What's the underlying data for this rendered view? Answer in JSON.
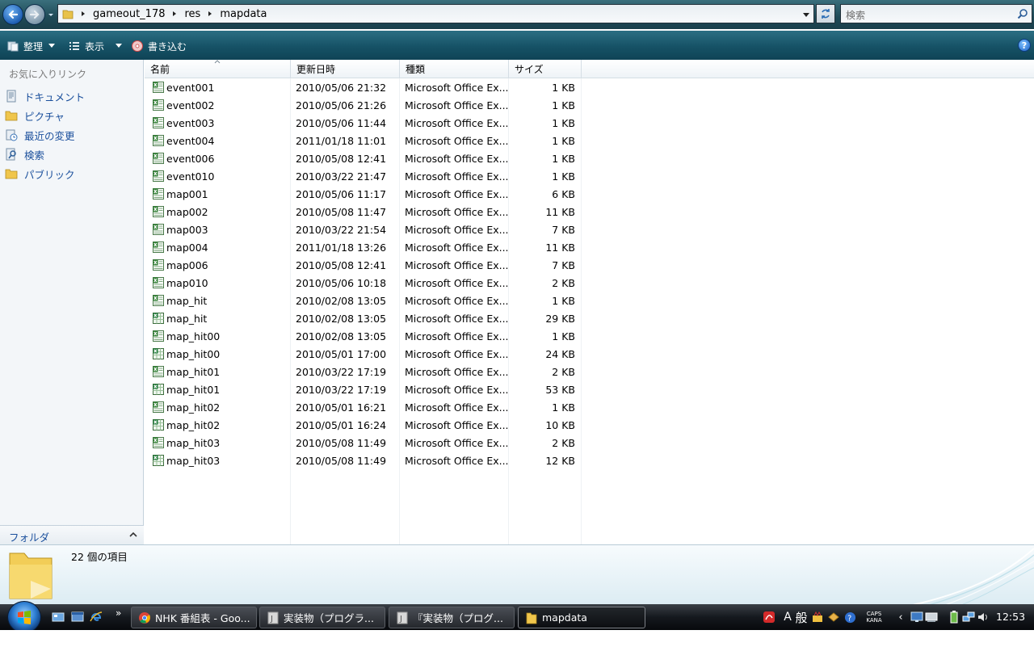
{
  "address": {
    "breadcrumbs": [
      "gameout_178",
      "res",
      "mapdata"
    ],
    "search_placeholder": "検索"
  },
  "commands": {
    "organize": "整理",
    "views": "表示",
    "burn": "書き込む"
  },
  "nav_pane": {
    "favorites_title": "お気に入りリンク",
    "items": [
      {
        "label": "ドキュメント",
        "icon": "documents-icon"
      },
      {
        "label": "ピクチャ",
        "icon": "pictures-folder-icon"
      },
      {
        "label": "最近の変更",
        "icon": "recent-changes-icon"
      },
      {
        "label": "検索",
        "icon": "searches-icon"
      },
      {
        "label": "パブリック",
        "icon": "public-folder-icon"
      }
    ],
    "folders_label": "フォルダ"
  },
  "file_list": {
    "columns": [
      "名前",
      "更新日時",
      "種類",
      "サイズ"
    ],
    "rows": [
      {
        "name": "event001",
        "date": "2010/05/06 21:32",
        "type": "Microsoft Office Ex...",
        "size": "1 KB",
        "icon": "excel-csv-icon"
      },
      {
        "name": "event002",
        "date": "2010/05/06 21:26",
        "type": "Microsoft Office Ex...",
        "size": "1 KB",
        "icon": "excel-csv-icon"
      },
      {
        "name": "event003",
        "date": "2010/05/06 11:44",
        "type": "Microsoft Office Ex...",
        "size": "1 KB",
        "icon": "excel-csv-icon"
      },
      {
        "name": "event004",
        "date": "2011/01/18 11:01",
        "type": "Microsoft Office Ex...",
        "size": "1 KB",
        "icon": "excel-csv-icon"
      },
      {
        "name": "event006",
        "date": "2010/05/08 12:41",
        "type": "Microsoft Office Ex...",
        "size": "1 KB",
        "icon": "excel-csv-icon"
      },
      {
        "name": "event010",
        "date": "2010/03/22 21:47",
        "type": "Microsoft Office Ex...",
        "size": "1 KB",
        "icon": "excel-csv-icon"
      },
      {
        "name": "map001",
        "date": "2010/05/06 11:17",
        "type": "Microsoft Office Ex...",
        "size": "6 KB",
        "icon": "excel-csv-icon"
      },
      {
        "name": "map002",
        "date": "2010/05/08 11:47",
        "type": "Microsoft Office Ex...",
        "size": "11 KB",
        "icon": "excel-csv-icon"
      },
      {
        "name": "map003",
        "date": "2010/03/22 21:54",
        "type": "Microsoft Office Ex...",
        "size": "7 KB",
        "icon": "excel-csv-icon"
      },
      {
        "name": "map004",
        "date": "2011/01/18 13:26",
        "type": "Microsoft Office Ex...",
        "size": "11 KB",
        "icon": "excel-csv-icon"
      },
      {
        "name": "map006",
        "date": "2010/05/08 12:41",
        "type": "Microsoft Office Ex...",
        "size": "7 KB",
        "icon": "excel-csv-icon"
      },
      {
        "name": "map010",
        "date": "2010/05/06 10:18",
        "type": "Microsoft Office Ex...",
        "size": "2 KB",
        "icon": "excel-csv-icon"
      },
      {
        "name": "map_hit",
        "date": "2010/02/08 13:05",
        "type": "Microsoft Office Ex...",
        "size": "1 KB",
        "icon": "excel-csv-icon"
      },
      {
        "name": "map_hit",
        "date": "2010/02/08 13:05",
        "type": "Microsoft Office Ex...",
        "size": "29 KB",
        "icon": "excel-workbook-icon"
      },
      {
        "name": "map_hit00",
        "date": "2010/02/08 13:05",
        "type": "Microsoft Office Ex...",
        "size": "1 KB",
        "icon": "excel-csv-icon"
      },
      {
        "name": "map_hit00",
        "date": "2010/05/01 17:00",
        "type": "Microsoft Office Ex...",
        "size": "24 KB",
        "icon": "excel-workbook-icon"
      },
      {
        "name": "map_hit01",
        "date": "2010/03/22 17:19",
        "type": "Microsoft Office Ex...",
        "size": "2 KB",
        "icon": "excel-csv-icon"
      },
      {
        "name": "map_hit01",
        "date": "2010/03/22 17:19",
        "type": "Microsoft Office Ex...",
        "size": "53 KB",
        "icon": "excel-workbook-icon"
      },
      {
        "name": "map_hit02",
        "date": "2010/05/01 16:21",
        "type": "Microsoft Office Ex...",
        "size": "1 KB",
        "icon": "excel-csv-icon"
      },
      {
        "name": "map_hit02",
        "date": "2010/05/01 16:24",
        "type": "Microsoft Office Ex...",
        "size": "10 KB",
        "icon": "excel-workbook-icon"
      },
      {
        "name": "map_hit03",
        "date": "2010/05/08 11:49",
        "type": "Microsoft Office Ex...",
        "size": "2 KB",
        "icon": "excel-csv-icon"
      },
      {
        "name": "map_hit03",
        "date": "2010/05/08 11:49",
        "type": "Microsoft Office Ex...",
        "size": "12 KB",
        "icon": "excel-workbook-icon"
      }
    ]
  },
  "details": {
    "item_count": "22 個の項目"
  },
  "taskbar": {
    "buttons": [
      {
        "label": "NHK 番組表 - Goo...",
        "icon": "chrome-icon",
        "active": false
      },
      {
        "label": "実装物（プログラ...",
        "icon": "document-j-icon",
        "active": false
      },
      {
        "label": "『実装物（プログ...",
        "icon": "document-j-icon",
        "active": false
      },
      {
        "label": "mapdata",
        "icon": "folder-icon",
        "active": true
      }
    ],
    "ime_mode": "A",
    "ime_kanji": "般",
    "caps_label": "CAPS",
    "kana_label": "KANA",
    "clock": "12:53"
  },
  "colors": {
    "link": "#1a4f9c",
    "taskbar": "#15191e",
    "command_bar": "#165266"
  }
}
